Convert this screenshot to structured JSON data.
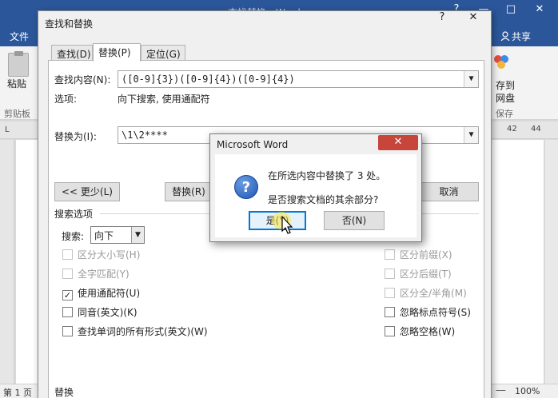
{
  "word": {
    "title": "查找替换 - Word",
    "window_buttons": [
      "?",
      "—",
      "□",
      "✕"
    ],
    "file_tab": "文件",
    "share": "共享",
    "paste_label": "粘贴",
    "clipboard_group": "剪贴板",
    "save_label_1": "存到",
    "save_label_2": "网盘",
    "save_group": "保存",
    "ruler_left": "L",
    "ruler_numbers": [
      "42",
      "44"
    ],
    "status_page": "第 1 页",
    "zoom": "100%",
    "zoom_minus": "—"
  },
  "dialog": {
    "title": "查找和替换",
    "help": "?",
    "close": "✕",
    "tabs": [
      "查找(D)",
      "替换(P)",
      "定位(G)"
    ],
    "find_label": "查找内容(N):",
    "find_value": "([0-9]{3})([0-9]{4})([0-9]{4})",
    "options_label": "选项:",
    "options_value": "向下搜索, 使用通配符",
    "replace_label": "替换为(I):",
    "replace_value": "\\1\\2****",
    "less_button": "<< 更少(L)",
    "replace_button": "替换(R)",
    "cancel_button": "取消",
    "search_options_title": "搜索选项",
    "search_label": "搜索:",
    "search_value": "向下",
    "left_options": [
      {
        "label": "区分大小写(H)",
        "checked": false,
        "disabled": true
      },
      {
        "label": "全字匹配(Y)",
        "checked": false,
        "disabled": true
      },
      {
        "label": "使用通配符(U)",
        "checked": true,
        "disabled": false
      },
      {
        "label": "同音(英文)(K)",
        "checked": false,
        "disabled": false
      },
      {
        "label": "查找单词的所有形式(英文)(W)",
        "checked": false,
        "disabled": false
      }
    ],
    "right_options": [
      {
        "label": "区分前缀(X)",
        "checked": false,
        "disabled": true
      },
      {
        "label": "区分后缀(T)",
        "checked": false,
        "disabled": true
      },
      {
        "label": "区分全/半角(M)",
        "checked": false,
        "disabled": true
      },
      {
        "label": "忽略标点符号(S)",
        "checked": false,
        "disabled": false
      },
      {
        "label": "忽略空格(W)",
        "checked": false,
        "disabled": false
      }
    ],
    "replace_section": "替换"
  },
  "message_box": {
    "title": "Microsoft Word",
    "close": "✕",
    "line1": "在所选内容中替换了 3 处。",
    "line2": "是否搜索文档的其余部分?",
    "yes_button": "是(Y)",
    "no_button": "否(N)",
    "icon": "question-icon"
  },
  "colors": {
    "word_blue": "#2b579a",
    "close_red": "#c7453a",
    "focus_blue": "#0078d7"
  }
}
